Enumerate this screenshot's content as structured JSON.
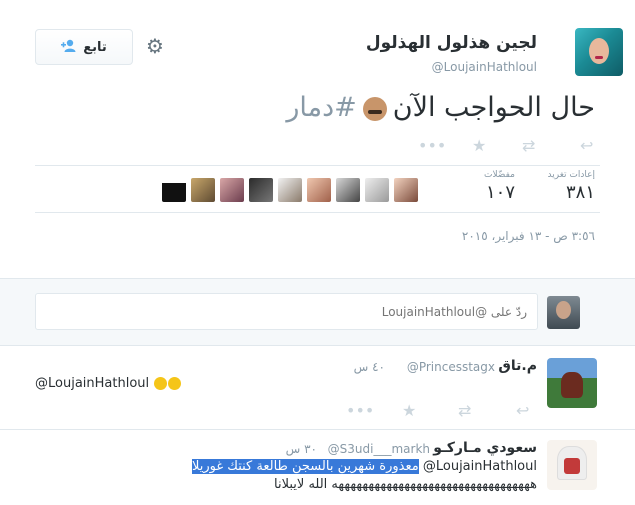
{
  "tweet": {
    "author_name": "لجين هذلول الهذلول",
    "author_handle": "@LoujainHathloul",
    "follow_label": "تابع",
    "text_main": "حال الحواجب الآن",
    "text_hashtag": "#دمار",
    "retweets_label": "إعادات تغريد",
    "retweets_count": "٣٨١",
    "favorites_label": "مفضّلات",
    "favorites_count": "١٠٧",
    "timestamp": "٣:٥٦ ص - ١٣ فبراير، ٢٠١٥",
    "icons": {
      "reply": "reply-icon",
      "retweet": "retweet-icon",
      "favorite": "star-icon",
      "more": "more-icon",
      "settings": "gear-icon",
      "follow": "add-user-icon"
    }
  },
  "reply_box": {
    "placeholder": "ردّ على @LoujainHathloul"
  },
  "replies": [
    {
      "name": "م.تاق",
      "handle": "@Princesstagx",
      "time": "٤٠ س",
      "text": "@LoujainHathloul"
    },
    {
      "name": "سعودي مـاركـو",
      "handle": "@S3udi___markh",
      "time": "٣٠ س",
      "mention": "@LoujainHathloul",
      "text_highlighted": "معذورة شهرين بالسجن طالعة كنتك غوريلا",
      "text_line2": "هههههههههههههههههههههههههههههههههه الله لايبلانا"
    }
  ],
  "colors": {
    "accent": "#55acee",
    "muted": "#8899a6",
    "border": "#e1e8ed",
    "selection": "#3879d9"
  }
}
